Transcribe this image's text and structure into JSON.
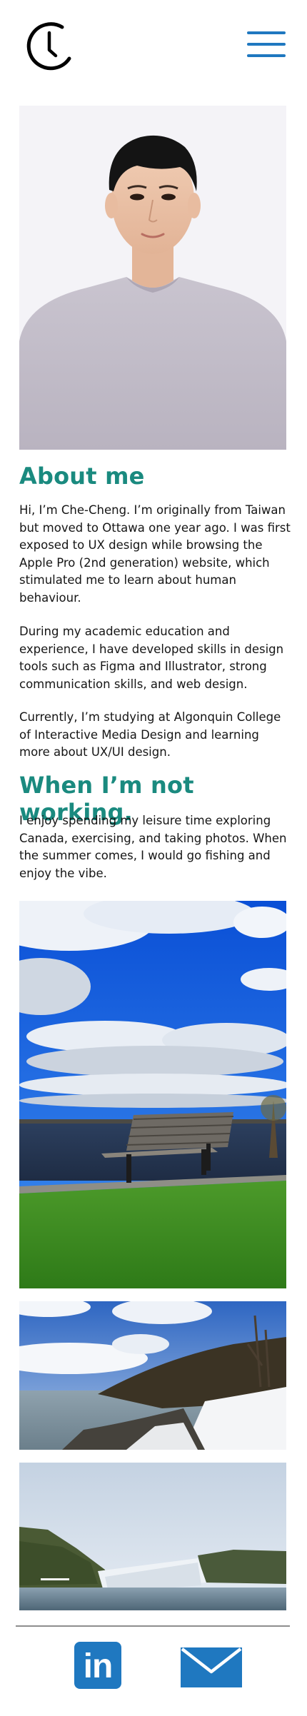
{
  "header": {
    "logo_icon": "clock-icon",
    "menu_icon": "hamburger-menu-icon"
  },
  "about": {
    "heading": "About me",
    "paragraphs": [
      "Hi, I’m Che-Cheng. I’m originally from Taiwan but moved to Ottawa one year ago. I was first exposed to UX design while browsing the Apple Pro (2nd generation) website, which stimulated me to learn about human behaviour.",
      "During my academic education and experience, I have developed skills in design tools such as Figma and Illustrator, strong communication skills, and web design.",
      "Currently, I’m studying at Algonquin College of Interactive Media Design and learning more about UX/UI design."
    ]
  },
  "not_working": {
    "heading": "When I’m not working.",
    "paragraph": "I enjoy spending my leisure time exploring Canada, exercising, and taking photos. When the summer comes, I would go fishing and enjoy the vibe."
  },
  "footer": {
    "linkedin_icon": "linkedin-icon",
    "linkedin_label": "in",
    "mail_icon": "mail-icon"
  },
  "colors": {
    "heading": "#1a8a7f",
    "accent": "#1f78c0",
    "divider": "#8e8e8e"
  }
}
